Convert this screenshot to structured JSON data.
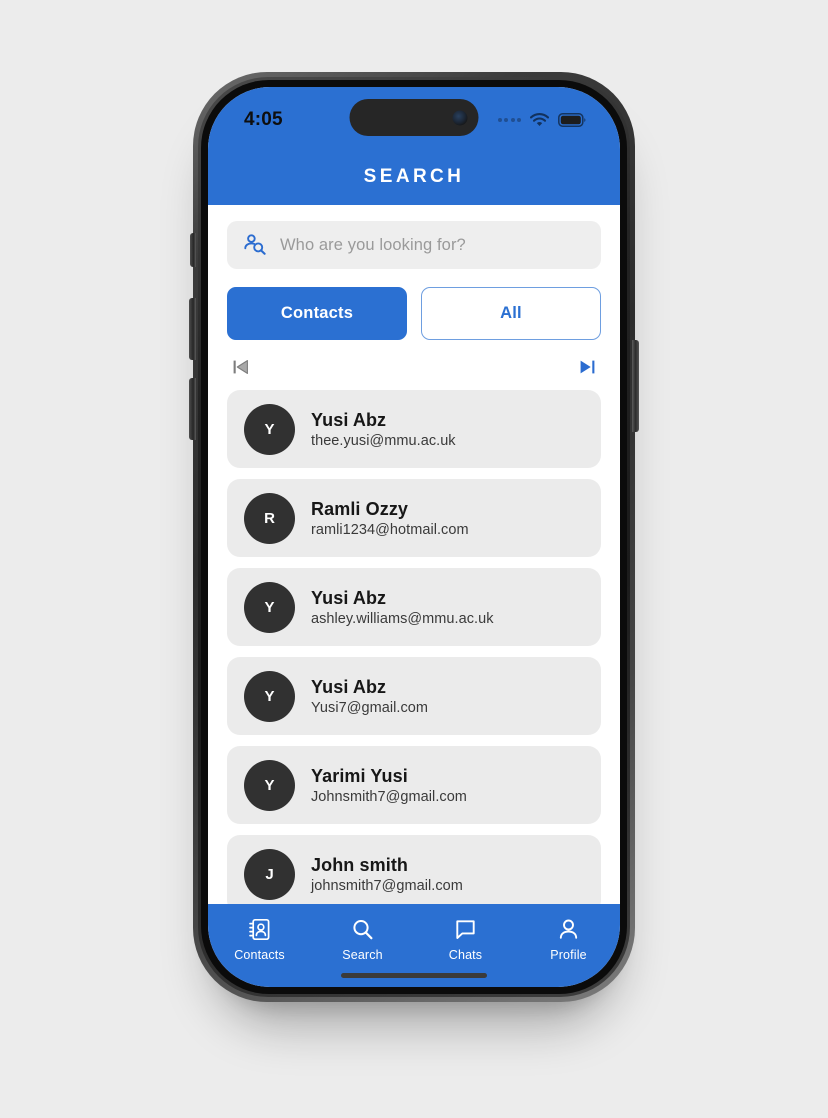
{
  "device": {
    "statusbar": {
      "time": "4:05",
      "cellular_icon": "cellular-dots-icon",
      "wifi_icon": "wifi-icon",
      "battery_icon": "battery-icon"
    },
    "dynamic_island": "dynamic-island",
    "home_indicator": "home-indicator"
  },
  "header": {
    "title": "SEARCH",
    "bg_color": "#2b70d2"
  },
  "search": {
    "icon": "person-search-icon",
    "placeholder": "Who are you looking for?",
    "value": "",
    "icon_color": "#2b70d2",
    "field_bg": "#eeeeee"
  },
  "segments": [
    {
      "label": "Contacts",
      "selected": true
    },
    {
      "label": "All",
      "selected": false
    }
  ],
  "pager": {
    "prev_icon": "skip-previous-icon",
    "prev_enabled": false,
    "prev_color": "#7a7a7a",
    "next_icon": "skip-next-icon",
    "next_enabled": true,
    "next_color": "#2b70d2"
  },
  "contacts": [
    {
      "initial": "Y",
      "name": "Yusi Abz",
      "email": "thee.yusi@mmu.ac.uk"
    },
    {
      "initial": "R",
      "name": "Ramli Ozzy",
      "email": "ramli1234@hotmail.com"
    },
    {
      "initial": "Y",
      "name": "Yusi Abz",
      "email": "ashley.williams@mmu.ac.uk"
    },
    {
      "initial": "Y",
      "name": "Yusi Abz",
      "email": "Yusi7@gmail.com"
    },
    {
      "initial": "Y",
      "name": "Yarimi Yusi",
      "email": "Johnsmith7@gmail.com"
    },
    {
      "initial": "J",
      "name": "John smith",
      "email": "johnsmith7@gmail.com"
    }
  ],
  "bottom_nav": {
    "bg_color": "#2b70d2",
    "items": [
      {
        "label": "Contacts",
        "icon": "contact-book-icon"
      },
      {
        "label": "Search",
        "icon": "search-icon"
      },
      {
        "label": "Chats",
        "icon": "chat-bubble-icon"
      },
      {
        "label": "Profile",
        "icon": "person-icon"
      }
    ]
  },
  "avatar_color": "#313131",
  "card_bg": "#ebebeb"
}
